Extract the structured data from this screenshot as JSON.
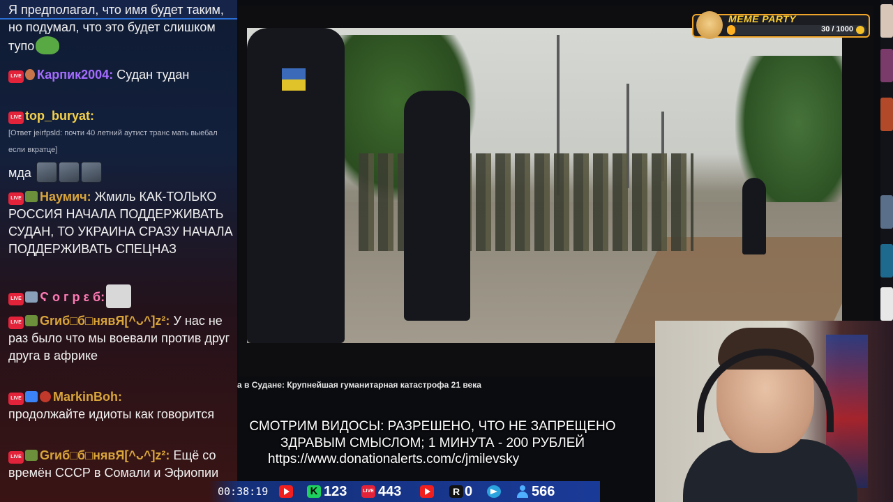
{
  "chat": {
    "messages": [
      {
        "text": "Я предполагал, что имя будет таким, но подумал, что это будет слишком тупо",
        "emote": "pepe"
      },
      {
        "nick": "Карпик2004:",
        "text": " Судан тудан"
      },
      {
        "nick": "top_buryat:",
        "reply": "[Ответ jeirfpsld: почти 40 летний аутист транс мать выебал если вкратце]"
      },
      {
        "text": "мда",
        "emote": "three-faces"
      },
      {
        "nick": "Наумич:",
        "text": " Жмиль КАК-ТОЛЬКО РОССИЯ НАЧАЛА ПОДДЕРЖИВАТЬ СУДАН, ТО УКРАИНА СРАЗУ НАЧАЛА ПОДДЕРЖИВАТЬ СПЕЦНАЗ",
        "bold_word": "Жмиль"
      },
      {
        "nick": "Ϛ о г р ε б:",
        "emote": "sorry"
      },
      {
        "nick": "Grиб□б□нявЯ[^ᴗ^]z²:",
        "text": " У нас не раз было что мы воевали против друг друга в африке"
      },
      {
        "nick": "MarkinBoh:",
        "text": "продолжайте идиоты как говорится"
      },
      {
        "nick": "Grиб□б□нявЯ[^ᴗ^]z²:",
        "text": " Ещё со времён СССР в Сомали и Эфиопии"
      }
    ],
    "live_badge": "LIVE"
  },
  "video": {
    "caption": "а в Судане: Крупнейшая гуманитарная катастрофа 21 века"
  },
  "meme_party": {
    "title": "MEME PARTY",
    "count": "30 / 1000",
    "progress": 0.03
  },
  "info": {
    "line1": "СМОТРИМ ВИДОСЫ: РАЗРЕШЕНО, ЧТО НЕ ЗАПРЕЩЕНО",
    "line2": "ЗДРАВЫМ СМЫСЛОМ; 1 МИНУТА - 200 РУБЛЕЙ",
    "url": "https://www.donationalerts.com/c/jmilevsky"
  },
  "stats": {
    "time": "00:38:19",
    "kick": "123",
    "live": "443",
    "rutube": "0",
    "viewers": "566",
    "kick_letter": "K",
    "rutube_letter": "R"
  },
  "colors": {
    "accent_blue": "#1a3a98",
    "live_red": "#e3233a",
    "kick_green": "#1ed15e",
    "meme_gold": "#ffb020"
  }
}
